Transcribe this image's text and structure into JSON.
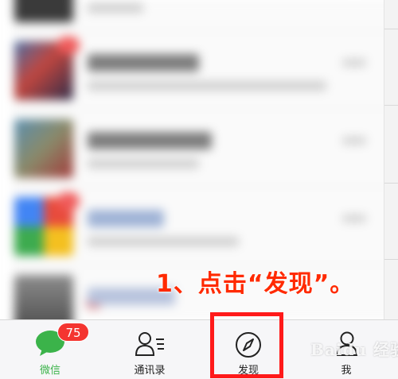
{
  "annotation": "1、点击“发现”。",
  "tabbar": {
    "tabs": [
      {
        "label": "微信",
        "icon": "chat-bubble-icon",
        "active": true,
        "badge": "75"
      },
      {
        "label": "通讯录",
        "icon": "contacts-icon",
        "active": false
      },
      {
        "label": "发现",
        "icon": "compass-icon",
        "active": false
      },
      {
        "label": "我",
        "icon": "person-icon",
        "active": false
      }
    ],
    "active_color": "#3bb34a",
    "badge_color": "#f43530"
  },
  "highlight_color": "#ff1a1a",
  "watermark": "Baidu 经验"
}
